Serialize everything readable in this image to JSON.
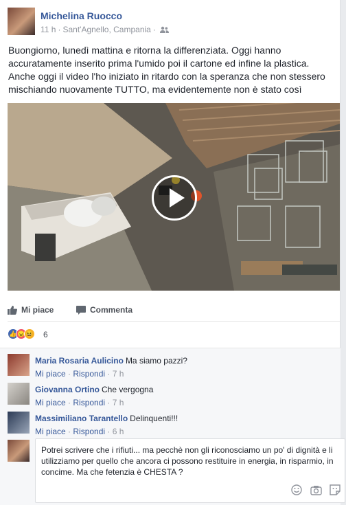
{
  "post": {
    "author": "Michelina Ruocco",
    "time": "11 h",
    "location": "Sant'Agnello, Campania",
    "text": "Buongiorno, lunedì mattina e ritorna la differenziata. Oggi hanno accuratamente inserito prima l'umido poi il cartone ed infine la plastica. Anche oggi il video l'ho iniziato in ritardo con la speranza che non stessero mischiando nuovamente TUTTO, ma evidentemente non è stato così"
  },
  "actions": {
    "like": "Mi piace",
    "comment": "Commenta"
  },
  "reactions": {
    "count": "6",
    "colors": [
      "#4267b2",
      "#f25268",
      "#f7b125"
    ]
  },
  "comments": [
    {
      "author": "Maria Rosaria Aulicino",
      "text": "Ma siamo pazzi?",
      "like": "Mi piace",
      "reply": "Rispondi",
      "time": "7 h"
    },
    {
      "author": "Giovanna Ortino",
      "text": "Che vergogna",
      "like": "Mi piace",
      "reply": "Rispondi",
      "time": "7 h"
    },
    {
      "author": "Massimiliano Tarantello",
      "text": "Delinquenti!!!",
      "like": "Mi piace",
      "reply": "Rispondi",
      "time": "6 h"
    }
  ],
  "composer": {
    "value": "Potrei scrivere che i rifiuti... ma pecchè non gli riconosciamo un po' di dignità e li utilizziamo per quello che ancora ci possono restituire in energia, in risparmio, in concime. Ma che fetenzia è CHESTA ?"
  }
}
